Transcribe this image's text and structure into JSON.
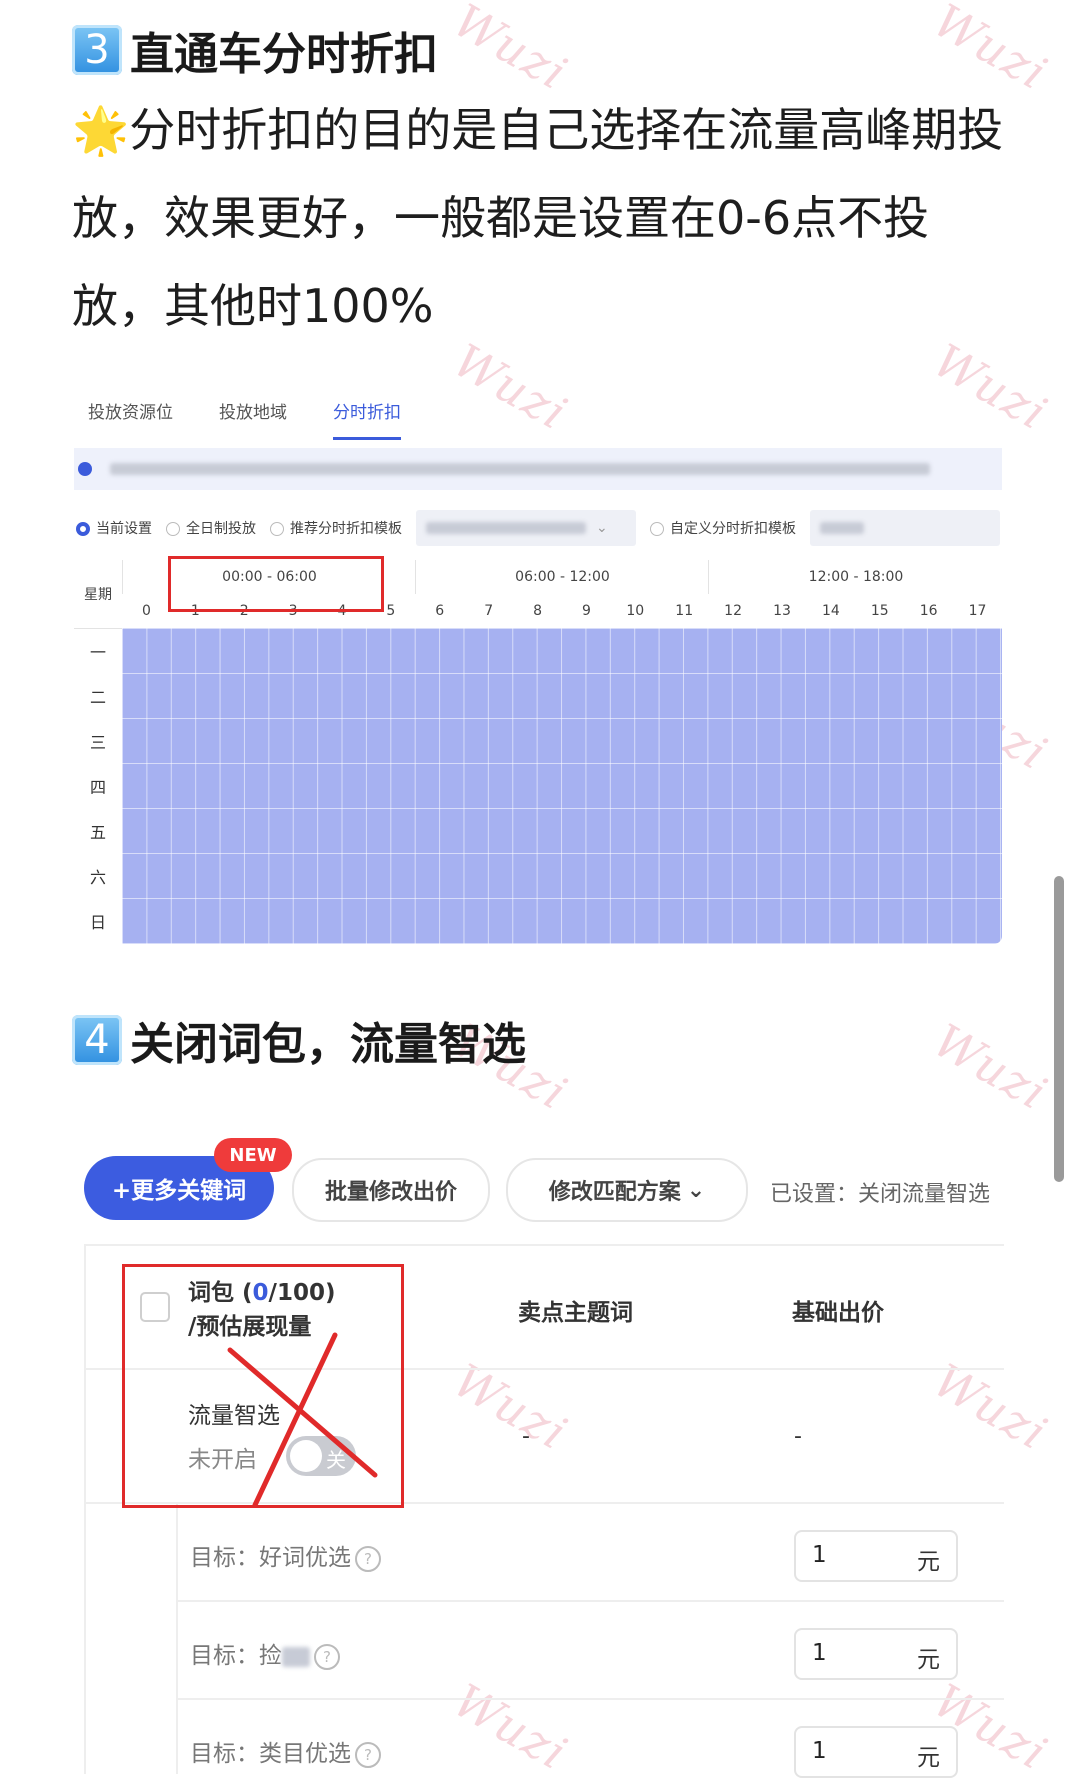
{
  "section3": {
    "num": "3",
    "title": "直通车分时折扣"
  },
  "paragraph": {
    "star": "🌟",
    "text": "分时折扣的目的是自己选择在流量高峰期投放，效果更好，一般都是设置在0-6点不投放，其他时100%"
  },
  "tabs": [
    {
      "label": "投放资源位"
    },
    {
      "label": "投放地域"
    },
    {
      "label": "分时折扣",
      "active": true
    }
  ],
  "options": {
    "current": "当前设置",
    "all_day": "全日制投放",
    "recommended": "推荐分时折扣模板",
    "custom": "自定义分时折扣模板"
  },
  "grid": {
    "week_label": "星期",
    "ranges": [
      "00:00 - 06:00",
      "06:00 - 12:00",
      "12:00 - 18:00"
    ],
    "hours": [
      "0",
      "1",
      "2",
      "3",
      "4",
      "5",
      "6",
      "7",
      "8",
      "9",
      "10",
      "11",
      "12",
      "13",
      "14",
      "15",
      "16",
      "17"
    ],
    "days": [
      "一",
      "二",
      "三",
      "四",
      "五",
      "六",
      "日"
    ],
    "fill_color": "#a6b1f1"
  },
  "section4": {
    "num": "4",
    "title": "关闭词包，流量智选"
  },
  "toolbar": {
    "add_keywords": "+更多关键词",
    "new_badge": "NEW",
    "batch_bid": "批量修改出价",
    "match_plan": "修改匹配方案",
    "set_status": "已设置：关闭流量智选"
  },
  "table": {
    "col1_line1_prefix": "词包 (",
    "col1_count": "0",
    "col1_line1_suffix": "/100)",
    "col1_line2": "/预估展现量",
    "col2": "卖点主题词",
    "col3": "基础出价",
    "smart_label": "流量智选",
    "smart_status": "未开启",
    "toggle_text": "关",
    "dash": "-",
    "goals": [
      {
        "label": "目标：好词优选",
        "value": "1",
        "unit": "元"
      },
      {
        "label": "目标：捡",
        "value": "1",
        "unit": "元"
      },
      {
        "label": "目标：类目优选",
        "value": "1",
        "unit": "元"
      }
    ]
  },
  "colors": {
    "accent": "#3b5bdb",
    "annotation_red": "#e02a2a",
    "badge_red": "#ef3b3b"
  },
  "watermark": "Wuzi"
}
